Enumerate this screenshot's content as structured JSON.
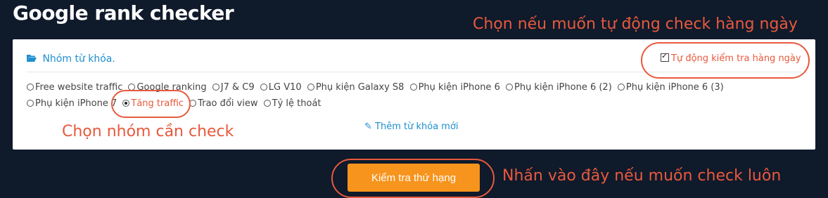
{
  "app": {
    "title": "Google rank checker"
  },
  "annotations": {
    "auto_check": "Chọn nếu muốn tự động check hàng ngày",
    "choose_group": "Chọn nhóm cần check",
    "check_now": "Nhấn vào đây nếu muốn check luôn"
  },
  "panel": {
    "group_heading": "Nhóm từ khóa.",
    "auto_check_label": "Tự động kiểm tra hàng ngày",
    "auto_check_checked": true,
    "groups_row1": [
      "Free website traffic",
      "Google ranking",
      "J7 & C9",
      "LG V10",
      "Phụ kiện Galaxy S8",
      "Phụ kiện iPhone 6",
      "Phụ kiện iPhone 6 (2)",
      "Phụ kiện iPhone 6 (3)"
    ],
    "groups_row2": [
      "Phụ kiện iPhone 7",
      "Tăng traffic",
      "Trao đổi view",
      "Tỷ lệ thoát"
    ],
    "selected_group": "Tăng traffic",
    "add_keyword_label": "Thêm từ khóa mới"
  },
  "actions": {
    "check_rank_label": "Kiểm tra thứ hạng"
  },
  "colors": {
    "accent_orange": "#f7941d",
    "annotation_red": "#e8593d",
    "link_blue": "#1e8fcf",
    "background": "#0f1a2b"
  }
}
